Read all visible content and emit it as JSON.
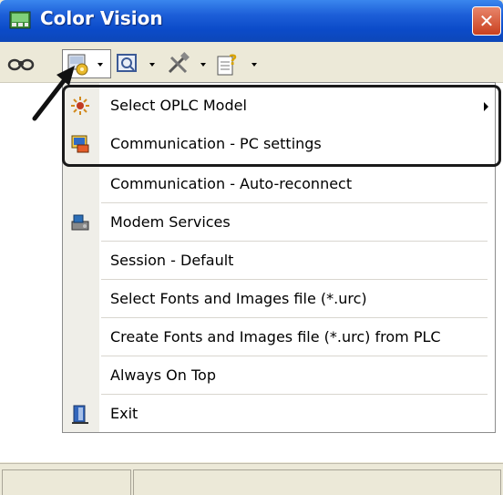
{
  "window": {
    "title": "Color Vision",
    "close_glyph": "✕"
  },
  "toolbar": {
    "buttons": [
      {
        "icon": "binoculars-icon"
      },
      {
        "icon": "plc-settings-icon",
        "pressed": true,
        "has_dropdown": true
      },
      {
        "icon": "screen-icon",
        "has_dropdown": true
      },
      {
        "icon": "tools-icon",
        "has_dropdown": true
      },
      {
        "icon": "help-icon",
        "has_dropdown": true
      }
    ]
  },
  "menu": {
    "items": [
      {
        "label": "Select OPLC Model",
        "icon": "plc-model-icon",
        "has_submenu": true
      },
      {
        "label": "Communication - PC settings",
        "icon": "pc-settings-icon"
      },
      {
        "label": "Communication - Auto-reconnect",
        "icon": ""
      },
      {
        "label": "Modem Services",
        "icon": "modem-icon"
      },
      {
        "label": "Session - Default",
        "icon": ""
      },
      {
        "label": "Select Fonts and Images file (*.urc)",
        "icon": ""
      },
      {
        "label": "Create Fonts and Images file (*.urc) from PLC",
        "icon": ""
      },
      {
        "label": "Always On Top",
        "icon": ""
      },
      {
        "label": "Exit",
        "icon": "exit-icon"
      }
    ]
  },
  "colors": {
    "titlebar": "#0b4bc9",
    "close": "#d9542b",
    "highlight_border": "#1a1a1a"
  }
}
